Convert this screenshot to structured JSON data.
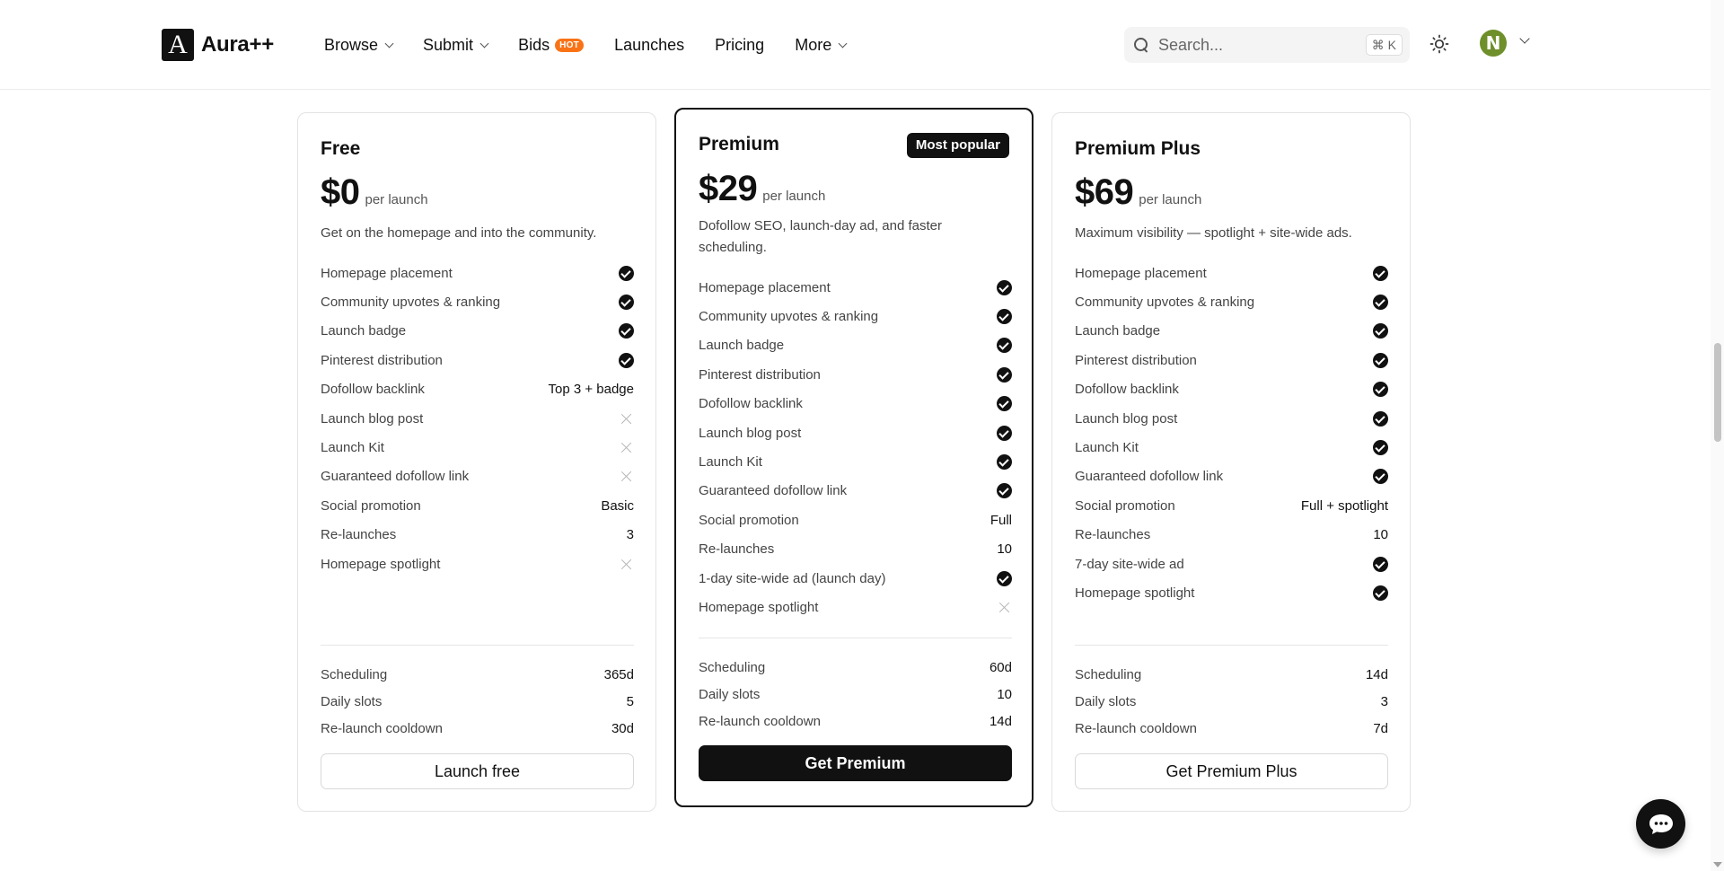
{
  "brand": {
    "logo_letter": "A",
    "name": "Aura++"
  },
  "nav": {
    "browse": "Browse",
    "submit": "Submit",
    "bids": "Bids",
    "hot_badge": "HOT",
    "launches": "Launches",
    "pricing": "Pricing",
    "more": "More"
  },
  "search": {
    "placeholder": "Search...",
    "shortcut": "⌘ K"
  },
  "user": {
    "avatar_initial": "N"
  },
  "plans": [
    {
      "name": "Free",
      "price": "$0",
      "per": "per launch",
      "description": "Get on the homepage and into the community.",
      "features": [
        {
          "label": "Homepage placement",
          "status": "check"
        },
        {
          "label": "Community upvotes & ranking",
          "status": "check"
        },
        {
          "label": "Launch badge",
          "status": "check"
        },
        {
          "label": "Pinterest distribution",
          "status": "check"
        },
        {
          "label": "Dofollow backlink",
          "status": "text",
          "value": "Top 3 + badge"
        },
        {
          "label": "Launch blog post",
          "status": "cross"
        },
        {
          "label": "Launch Kit",
          "status": "cross"
        },
        {
          "label": "Guaranteed dofollow link",
          "status": "cross"
        },
        {
          "label": "Social promotion",
          "status": "text",
          "value": "Basic"
        },
        {
          "label": "Re-launches",
          "status": "text",
          "value": "3"
        },
        {
          "label": "Homepage spotlight",
          "status": "cross"
        }
      ],
      "stats": [
        {
          "label": "Scheduling",
          "value": "365d"
        },
        {
          "label": "Daily slots",
          "value": "5"
        },
        {
          "label": "Re-launch cooldown",
          "value": "30d"
        }
      ],
      "cta": "Launch free"
    },
    {
      "name": "Premium",
      "badge": "Most popular",
      "price": "$29",
      "per": "per launch",
      "description": "Dofollow SEO, launch-day ad, and faster scheduling.",
      "features": [
        {
          "label": "Homepage placement",
          "status": "check"
        },
        {
          "label": "Community upvotes & ranking",
          "status": "check"
        },
        {
          "label": "Launch badge",
          "status": "check"
        },
        {
          "label": "Pinterest distribution",
          "status": "check"
        },
        {
          "label": "Dofollow backlink",
          "status": "check"
        },
        {
          "label": "Launch blog post",
          "status": "check"
        },
        {
          "label": "Launch Kit",
          "status": "check"
        },
        {
          "label": "Guaranteed dofollow link",
          "status": "check"
        },
        {
          "label": "Social promotion",
          "status": "text",
          "value": "Full"
        },
        {
          "label": "Re-launches",
          "status": "text",
          "value": "10"
        },
        {
          "label": "1-day site-wide ad (launch day)",
          "status": "check"
        },
        {
          "label": "Homepage spotlight",
          "status": "cross"
        }
      ],
      "stats": [
        {
          "label": "Scheduling",
          "value": "60d"
        },
        {
          "label": "Daily slots",
          "value": "10"
        },
        {
          "label": "Re-launch cooldown",
          "value": "14d"
        }
      ],
      "cta": "Get Premium"
    },
    {
      "name": "Premium Plus",
      "price": "$69",
      "per": "per launch",
      "description": "Maximum visibility — spotlight + site-wide ads.",
      "features": [
        {
          "label": "Homepage placement",
          "status": "check"
        },
        {
          "label": "Community upvotes & ranking",
          "status": "check"
        },
        {
          "label": "Launch badge",
          "status": "check"
        },
        {
          "label": "Pinterest distribution",
          "status": "check"
        },
        {
          "label": "Dofollow backlink",
          "status": "check"
        },
        {
          "label": "Launch blog post",
          "status": "check"
        },
        {
          "label": "Launch Kit",
          "status": "check"
        },
        {
          "label": "Guaranteed dofollow link",
          "status": "check"
        },
        {
          "label": "Social promotion",
          "status": "text",
          "value": "Full + spotlight"
        },
        {
          "label": "Re-launches",
          "status": "text",
          "value": "10"
        },
        {
          "label": "7-day site-wide ad",
          "status": "check"
        },
        {
          "label": "Homepage spotlight",
          "status": "check"
        }
      ],
      "stats": [
        {
          "label": "Scheduling",
          "value": "14d"
        },
        {
          "label": "Daily slots",
          "value": "3"
        },
        {
          "label": "Re-launch cooldown",
          "value": "7d"
        }
      ],
      "cta": "Get Premium Plus"
    }
  ],
  "icons": {
    "search": "search-icon",
    "theme": "sun-icon",
    "chat": "chat-bubble-icon",
    "included": "check-circle-icon",
    "excluded": "x-icon"
  },
  "colors": {
    "accent_dark": "#111111",
    "hot_badge": "#f97316",
    "avatar": "#6e8f2a"
  }
}
